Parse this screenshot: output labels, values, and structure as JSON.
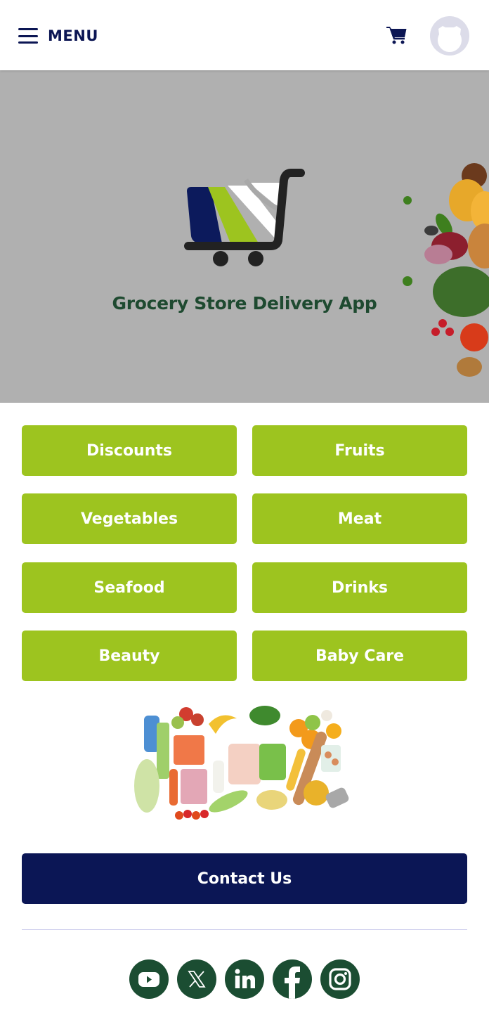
{
  "header": {
    "menu_label": "MENU",
    "icons": {
      "menu": "hamburger-icon",
      "cart": "shopping-cart-icon",
      "avatar": "user-avatar-icon"
    }
  },
  "hero": {
    "title": "Grocery Store Delivery App",
    "logo": "shopping-cart-logo",
    "colors": {
      "background": "#b0b0b0",
      "title": "#1e4a30",
      "logo_navy": "#0c1a5c",
      "logo_green": "#9dc41f",
      "logo_handle": "#222222"
    }
  },
  "categories": [
    {
      "label": "Discounts"
    },
    {
      "label": "Fruits"
    },
    {
      "label": "Vegetables"
    },
    {
      "label": "Meat"
    },
    {
      "label": "Seafood"
    },
    {
      "label": "Drinks"
    },
    {
      "label": "Beauty"
    },
    {
      "label": "Baby Care"
    }
  ],
  "contact": {
    "label": "Contact Us"
  },
  "social": [
    {
      "name": "YouTube",
      "icon": "youtube-icon"
    },
    {
      "name": "X",
      "icon": "x-twitter-icon"
    },
    {
      "name": "LinkedIn",
      "icon": "linkedin-icon"
    },
    {
      "name": "Facebook",
      "icon": "facebook-icon"
    },
    {
      "name": "Instagram",
      "icon": "instagram-icon"
    }
  ],
  "colors": {
    "accent_green": "#9dc41f",
    "navy": "#0b1655",
    "social_green": "#1b4d32",
    "divider": "#cfd0ee"
  }
}
